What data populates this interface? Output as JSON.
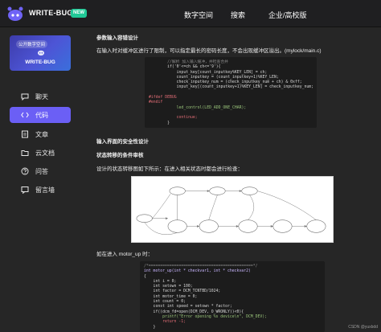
{
  "topbar": {
    "brand": "WRITE-BUG",
    "badge": "NEW",
    "nav": [
      "数字空间",
      "搜索",
      "企业/高校版"
    ]
  },
  "sidebar": {
    "banner_top": "公开数字空间",
    "banner_brand": "WRITE-BUG",
    "items": [
      {
        "label": "聊天",
        "icon": "chat-icon"
      },
      {
        "label": "代码",
        "icon": "code-icon",
        "active": true
      },
      {
        "label": "文章",
        "icon": "document-icon"
      },
      {
        "label": "云文档",
        "icon": "folder-icon"
      },
      {
        "label": "问答",
        "icon": "question-icon"
      },
      {
        "label": "留言墙",
        "icon": "message-board-icon"
      }
    ]
  },
  "content": {
    "h1": "参数输入容错设计",
    "p1": "在输入时对缓冲区进行了限制，可以指定最长的密码长度，不会出现缓冲区溢出。(mylock/main.c)",
    "code1": [
      {
        "t": "        //解析 加入输入缓冲，并检查合并",
        "c": "#8a8a8a"
      },
      {
        "t": "        if('0'<=ch && ch<='9'){",
        "c": "#d7d7d7"
      },
      {
        "t": "            input_key[count_inputkey%KEY_LEN] = ch;",
        "c": "#d7d7d7"
      },
      {
        "t": "            count_inputkey = (count_inputkey+1)%KEY_LEN;",
        "c": "#d7d7d7"
      },
      {
        "t": "            check_inputkey_num = (check_inputkey_num + ch) & 0xff;",
        "c": "#d7d7d7"
      },
      {
        "t": "            input_key[(count_inputkey+1)%KEY_LEN] = check_inputkey_num;",
        "c": "#d7d7d7"
      },
      {
        "t": "",
        "c": "#d7d7d7"
      },
      {
        "t": "#ifdef DEBUG",
        "c": "#e06c75"
      },
      {
        "t": "#endif",
        "c": "#e06c75"
      },
      {
        "t": "            led_control(LED_ADD_ONE_CHAR);",
        "c": "#98c379"
      },
      {
        "t": "",
        "c": "#d7d7d7"
      },
      {
        "t": "            continue;",
        "c": "#e06c75"
      },
      {
        "t": "        }",
        "c": "#d7d7d7"
      }
    ],
    "h2": "输入界面的安全性设计",
    "h3": "状态转移的条件审核",
    "p2": "设计的状态转移图如下所示：在进入相关状态时都会进行检查：",
    "p3": "如在进入 motor_up 时：",
    "code2": [
      {
        "t": "/*=============================================*/",
        "c": "#8a8a8a"
      },
      {
        "t": "int motor_up(int * checkvar1, int * checkvar2)",
        "c": "#c9b6ff"
      },
      {
        "t": "{",
        "c": "#d7d7d7"
      },
      {
        "t": "    int i = 0;",
        "c": "#d7d7d7"
      },
      {
        "t": "    int setown = 100;",
        "c": "#d7d7d7"
      },
      {
        "t": "    int factor = DCM_TCNTBD/1024;",
        "c": "#d7d7d7"
      },
      {
        "t": "    int motor_time = 0;",
        "c": "#d7d7d7"
      },
      {
        "t": "    int count = 0;",
        "c": "#d7d7d7"
      },
      {
        "t": "    const int speed = setown * factor;",
        "c": "#d7d7d7"
      },
      {
        "t": "    if((dcm_fd=open(DCM_DEV, O_WRONLY))<0){",
        "c": "#d7d7d7"
      },
      {
        "t": "        printf(\"Error opening %s device\\n\", DCM_DEV);",
        "c": "#98c379"
      },
      {
        "t": "        return -1;",
        "c": "#e06c75"
      },
      {
        "t": "    }",
        "c": "#d7d7d7"
      }
    ]
  },
  "watermark": "CSDN @yuxbdd"
}
